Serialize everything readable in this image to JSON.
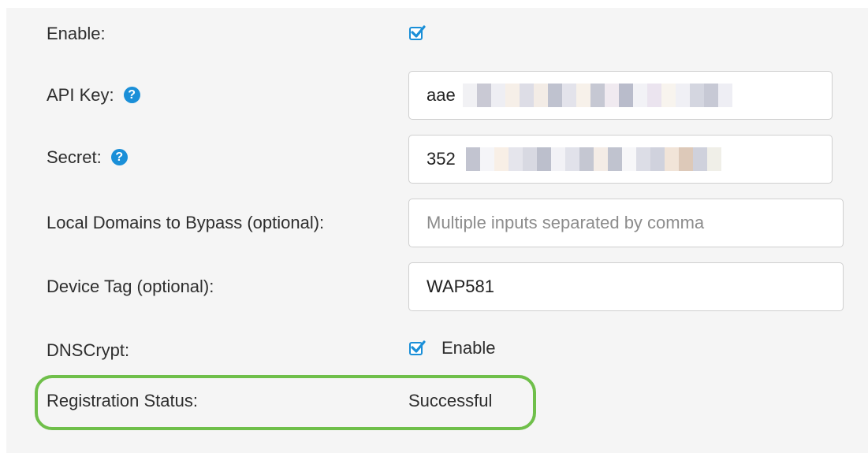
{
  "form": {
    "enable": {
      "label": "Enable:",
      "checked": true
    },
    "api_key": {
      "label": "API Key:",
      "help_icon": "?",
      "value_visible_prefix": "aae",
      "value_obscured": true
    },
    "secret": {
      "label": "Secret:",
      "help_icon": "?",
      "value_visible_prefix": "352",
      "value_obscured": true
    },
    "local_domains": {
      "label": "Local Domains to Bypass (optional):",
      "value": "",
      "placeholder": "Multiple inputs separated by comma"
    },
    "device_tag": {
      "label": "Device Tag (optional):",
      "value": "WAP581"
    },
    "dnscrypt": {
      "label": "DNSCrypt:",
      "checked": true,
      "checkbox_label": "Enable"
    },
    "registration_status": {
      "label": "Registration Status:",
      "value": "Successful"
    }
  },
  "colors": {
    "accent_blue": "#1a8fd8",
    "highlight_green": "#6fbf4a",
    "panel_bg": "#f5f5f5"
  },
  "icons": {
    "help": "question-circle-icon",
    "check": "checkmark-icon"
  }
}
